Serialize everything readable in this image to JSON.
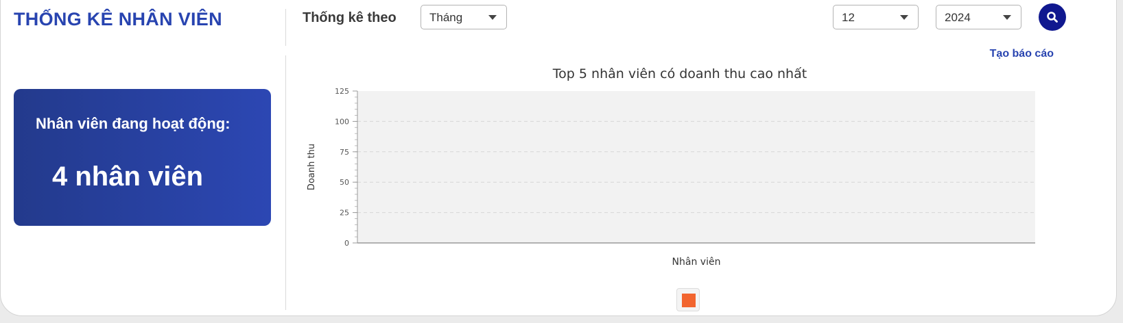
{
  "page_title": "THỐNG KÊ NHÂN VIÊN",
  "filter": {
    "label": "Thống kê theo",
    "period_value": "Tháng",
    "month_value": "12",
    "year_value": "2024"
  },
  "search_icon": "search-icon",
  "report_link": "Tạo báo cáo",
  "stat_card": {
    "label": "Nhân viên đang hoạt động:",
    "value": "4 nhân viên"
  },
  "colors": {
    "title": "#2844b0",
    "card_start": "#233a8c",
    "card_end": "#2c47b3",
    "search_button": "#10188f",
    "series": "#f2652f",
    "plot_bg": "#f2f2f2"
  },
  "chart_data": {
    "type": "bar",
    "title": "Top 5 nhân viên có doanh thu cao nhất",
    "xlabel": "Nhân viên",
    "ylabel": "Doanh thu",
    "ylim": [
      0,
      125
    ],
    "yticks": [
      0,
      25,
      50,
      75,
      100,
      125
    ],
    "categories": [],
    "series": [
      {
        "values": [],
        "color": "#f2652f"
      }
    ],
    "grid": true,
    "legend": "bottom"
  }
}
